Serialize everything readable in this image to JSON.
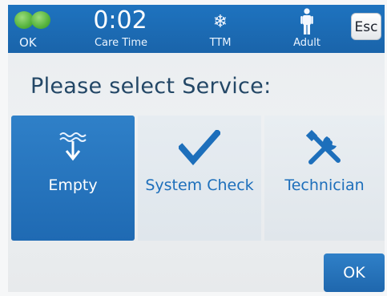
{
  "status_bar": {
    "status_label": "OK",
    "status_color": "#55b33d",
    "timer_value": "0:02",
    "timer_label": "Care Time",
    "mode_icon": "snowflake-icon",
    "mode_label": "TTM",
    "patient_icon": "adult-person-icon",
    "patient_label": "Adult",
    "esc_label": "Esc",
    "background_color": "#1e73bf"
  },
  "main": {
    "title": "Please select Service:",
    "tiles": [
      {
        "label": "Empty",
        "icon": "drain-water-icon",
        "selected": true
      },
      {
        "label": "System Check",
        "icon": "checkmark-icon",
        "selected": false
      },
      {
        "label": "Technician",
        "icon": "tools-icon",
        "selected": false
      }
    ],
    "selected_color": "#2f80c8",
    "accent_color": "#1d6fbb"
  },
  "footer": {
    "ok_label": "OK"
  }
}
